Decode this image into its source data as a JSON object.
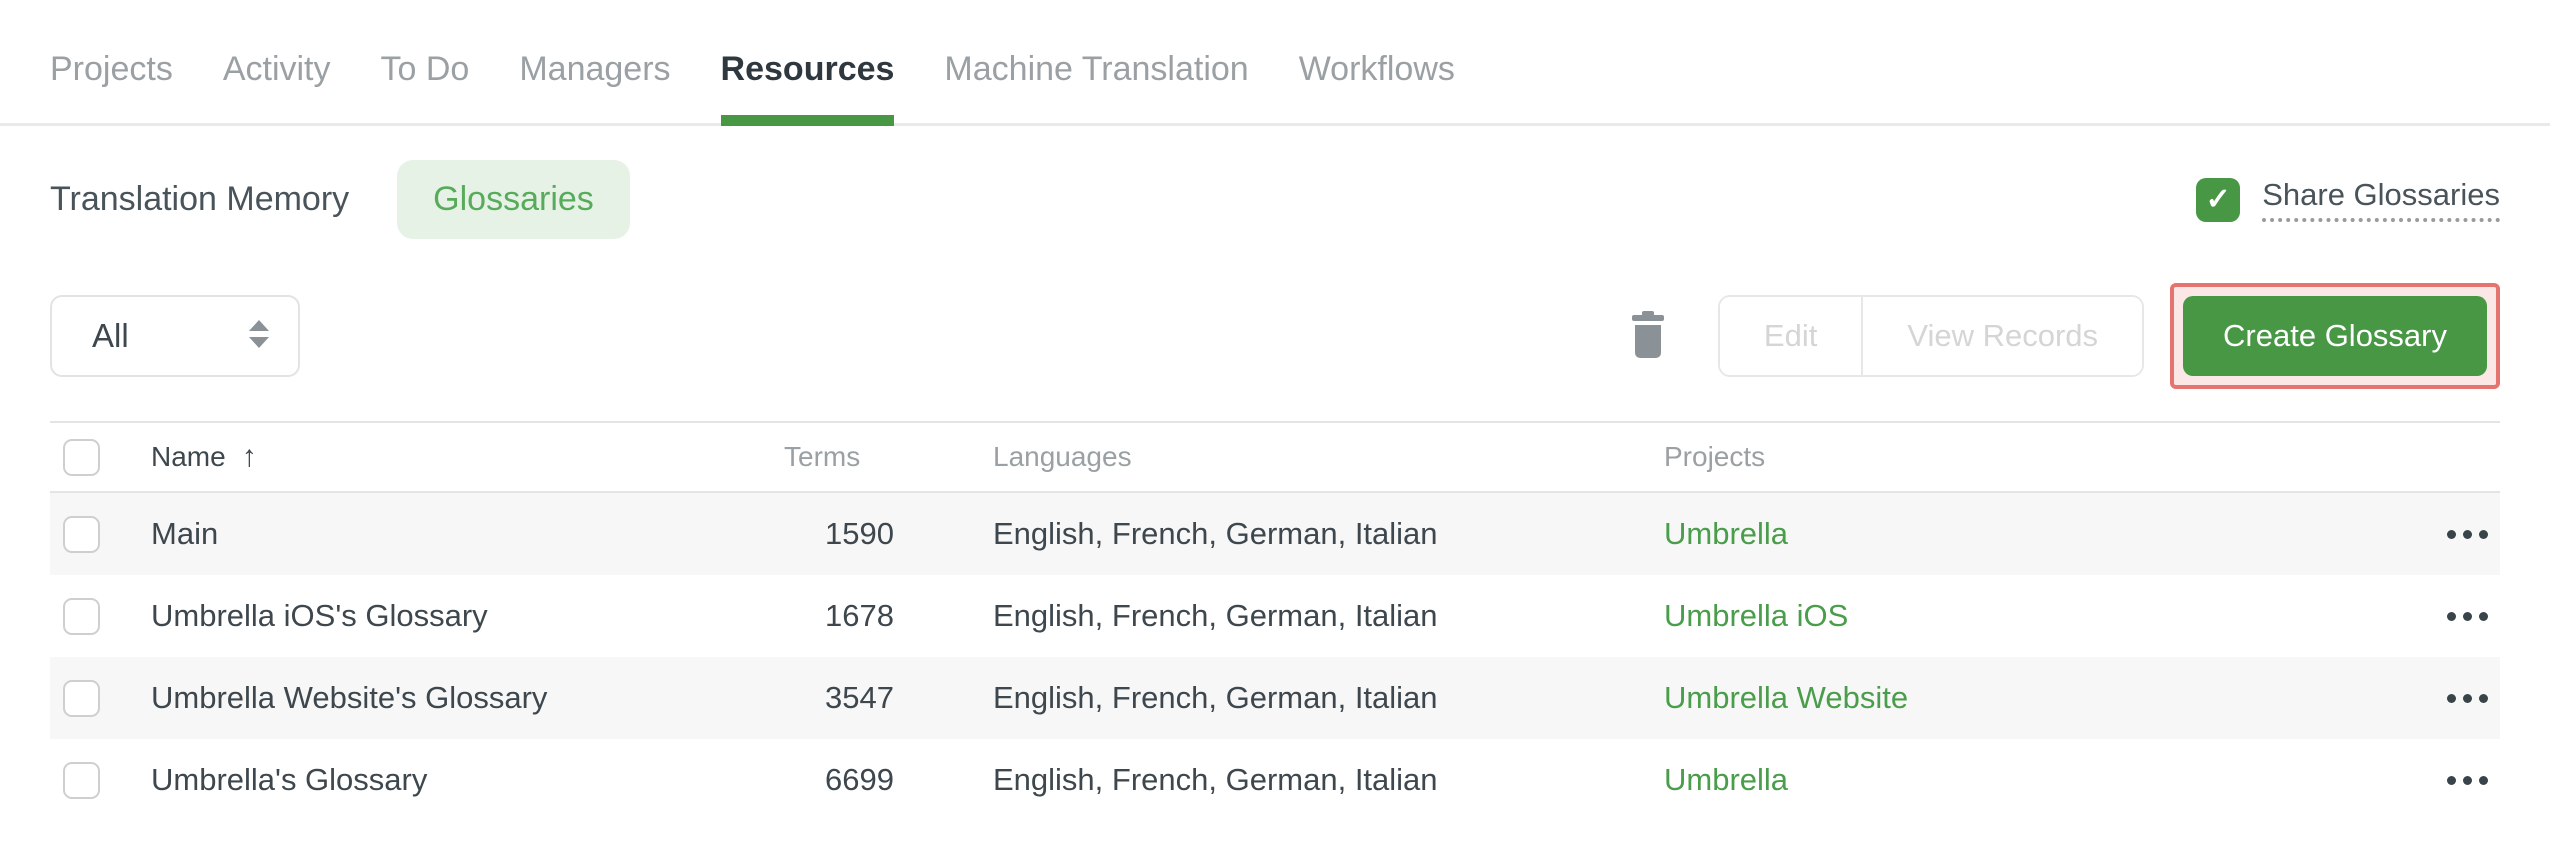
{
  "colors": {
    "accent_green": "#489745",
    "pill_bg": "#e7f2e7",
    "pill_text": "#57ab5a",
    "link_green": "#4a9d4a",
    "highlight_border": "#e57370",
    "highlight_bg": "#fbe7e6",
    "zebra_row": "#f7f7f7",
    "inactive_tab": "#9aa0a3"
  },
  "nav": {
    "tabs": [
      {
        "label": "Projects",
        "active": false
      },
      {
        "label": "Activity",
        "active": false
      },
      {
        "label": "To Do",
        "active": false
      },
      {
        "label": "Managers",
        "active": false
      },
      {
        "label": "Resources",
        "active": true
      },
      {
        "label": "Machine Translation",
        "active": false
      },
      {
        "label": "Workflows",
        "active": false
      }
    ]
  },
  "subnav": {
    "tabs": [
      {
        "label": "Translation Memory",
        "active": false
      },
      {
        "label": "Glossaries",
        "active": true
      }
    ],
    "share": {
      "label": "Share Glossaries",
      "checked": true,
      "check_icon": "✓"
    }
  },
  "toolbar": {
    "filter": {
      "value": "All"
    },
    "edit_label": "Edit",
    "view_records_label": "View Records",
    "create_label": "Create Glossary"
  },
  "table": {
    "columns": {
      "name": "Name",
      "terms": "Terms",
      "languages": "Languages",
      "projects": "Projects"
    },
    "sort": {
      "column": "Name",
      "direction": "ascending",
      "icon": "↑"
    },
    "rows": [
      {
        "name": "Main",
        "terms": "1590",
        "languages": "English, French, German, Italian",
        "project": "Umbrella"
      },
      {
        "name": "Umbrella iOS's Glossary",
        "terms": "1678",
        "languages": "English, French, German, Italian",
        "project": "Umbrella iOS"
      },
      {
        "name": "Umbrella Website's Glossary",
        "terms": "3547",
        "languages": "English, French, German, Italian",
        "project": "Umbrella Website"
      },
      {
        "name": "Umbrella's Glossary",
        "terms": "6699",
        "languages": "English, French, German, Italian",
        "project": "Umbrella"
      }
    ]
  }
}
